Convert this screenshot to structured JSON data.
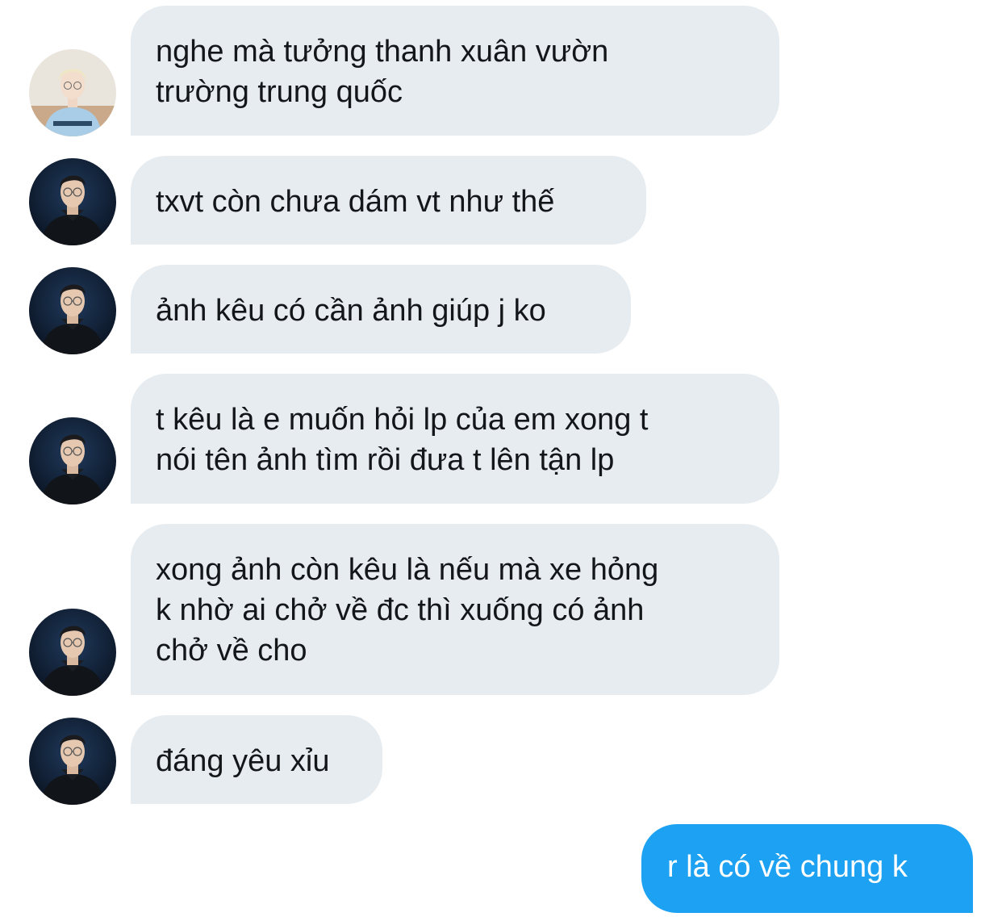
{
  "conversation": {
    "messages": [
      {
        "direction": "received",
        "sender_avatar": "light-hair-person-avatar",
        "lines": [
          "nghe mà tưởng thanh xuân vườn",
          "trường trung quốc"
        ]
      },
      {
        "direction": "received",
        "sender_avatar": "dark-hoodie-glasses-avatar",
        "lines": [
          "txvt còn chưa dám vt như thế"
        ]
      },
      {
        "direction": "received",
        "sender_avatar": "dark-hoodie-glasses-avatar",
        "lines": [
          "ảnh kêu có cần ảnh giúp j ko"
        ]
      },
      {
        "direction": "received",
        "sender_avatar": "dark-hoodie-glasses-avatar",
        "lines": [
          "t kêu là e muốn hỏi lp của em xong t",
          "nói tên ảnh tìm rồi đưa t lên tận lp"
        ]
      },
      {
        "direction": "received",
        "sender_avatar": "dark-hoodie-glasses-avatar",
        "lines": [
          "xong ảnh còn kêu là nếu mà xe hỏng",
          "k nhờ ai chở về đc thì xuống có ảnh",
          "chở về cho"
        ]
      },
      {
        "direction": "received",
        "sender_avatar": "dark-hoodie-glasses-avatar",
        "lines": [
          "đáng yêu xỉu"
        ]
      },
      {
        "direction": "sent",
        "lines": [
          "r là có về chung k"
        ]
      }
    ]
  },
  "colors": {
    "received_bubble": "#e6ecf0",
    "sent_bubble": "#1da1f2",
    "received_text": "#14171a",
    "sent_text": "#ffffff"
  }
}
